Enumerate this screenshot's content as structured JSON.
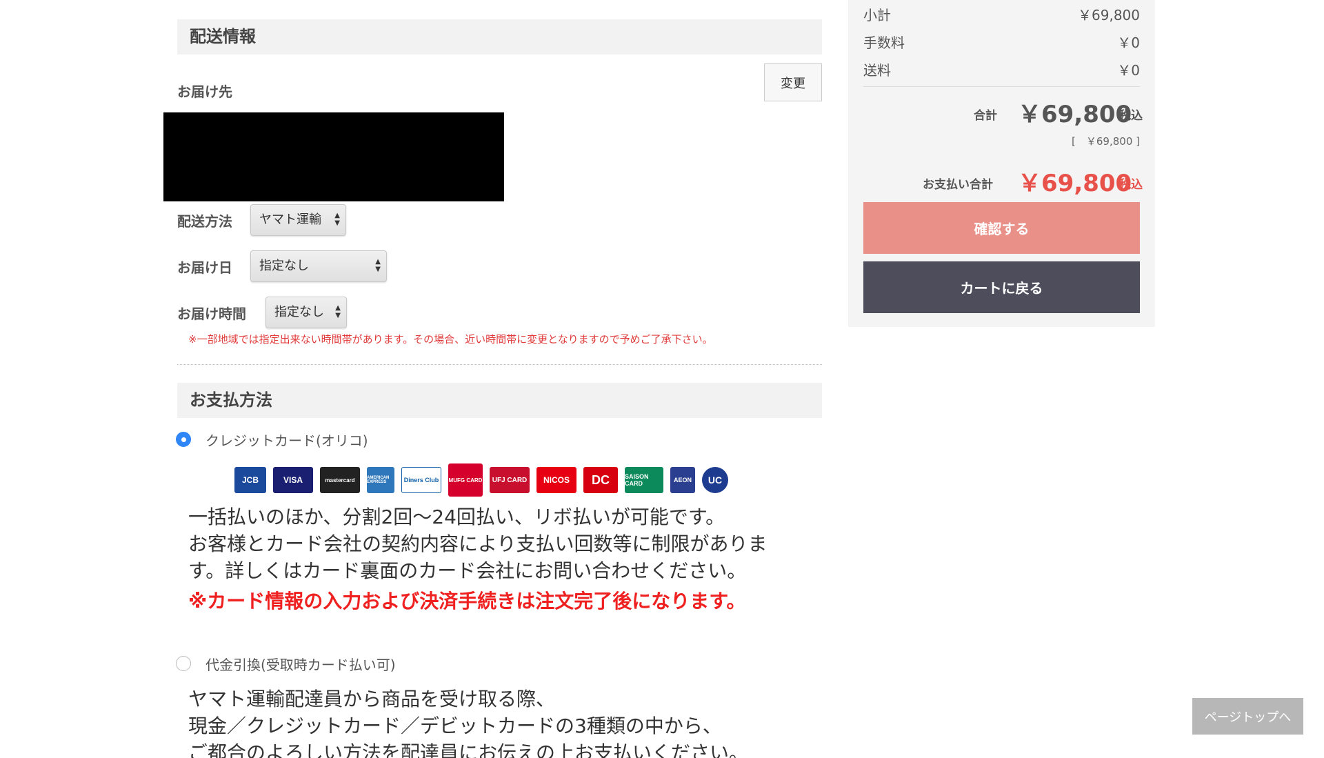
{
  "shipping": {
    "header": "配送情報",
    "destination_label": "お届け先",
    "change_button": "変更",
    "method_label": "配送方法",
    "method_value": "ヤマト運輸",
    "date_label": "お届け日",
    "date_value": "指定なし",
    "time_label": "お届け時間",
    "time_value": "指定なし",
    "notice": "※一部地域では指定出来ない時間帯があります。その場合、近い時間帯に変更となりますので予めご了承下さい。"
  },
  "payment": {
    "header": "お支払方法",
    "options": [
      {
        "label": "クレジットカード(オリコ)",
        "selected": true,
        "description": [
          "一括払いのほか、分割2回〜24回払い、リボ払いが可能です。",
          "お客様とカード会社の契約内容により支払い回数等に制限がありま",
          "す。詳しくはカード裏面のカード会社にお問い合わせください。"
        ],
        "warning": "※カード情報の入力および決済手続きは注文完了後になります。"
      },
      {
        "label": "代金引換(受取時カード払い可)",
        "selected": false,
        "description": [
          "ヤマト運輸配達員から商品を受け取る際、",
          "現金／クレジットカード／デビットカードの3種類の中から、",
          "ご都合のよろしい方法を配達員にお伝えの上お支払いください。"
        ]
      }
    ],
    "card_brands": [
      {
        "name": "jcb-logo",
        "text": "JCB",
        "color": "#1b4a9c"
      },
      {
        "name": "visa-logo",
        "text": "VISA",
        "color": "#1a1f71"
      },
      {
        "name": "mastercard-logo",
        "text": "mastercard",
        "color": "#222222"
      },
      {
        "name": "amex-logo",
        "text": "AMERICAN EXPRESS",
        "color": "#2e77bb"
      },
      {
        "name": "diners-logo",
        "text": "Diners Club",
        "color": "#0c5ea8"
      },
      {
        "name": "mufg-logo",
        "text": "MUFG CARD",
        "color": "#d5002b"
      },
      {
        "name": "ufj-logo",
        "text": "UFJ CARD",
        "color": "#c8102e"
      },
      {
        "name": "nicos-logo",
        "text": "NICOS",
        "color": "#e60012"
      },
      {
        "name": "dc-logo",
        "text": "DC",
        "color": "#d7000f"
      },
      {
        "name": "saison-logo",
        "text": "SAISON CARD",
        "color": "#0d8a5c"
      },
      {
        "name": "aeon-logo",
        "text": "AEON",
        "color": "#2a3f8f"
      },
      {
        "name": "uc-logo",
        "text": "UC",
        "color": "#1d3b8f"
      }
    ]
  },
  "summary": {
    "subtotal_label": "小計",
    "subtotal_value": "￥69,800",
    "fee_label": "手数料",
    "fee_value": "￥0",
    "shipping_label": "送料",
    "shipping_value": "￥0",
    "total_label": "合計",
    "total_value": "￥69,800",
    "tax_label": "税込",
    "tax_breakdown": "[　￥69,800 ]",
    "payment_total_label": "お支払い合計",
    "payment_total_value": "￥69,800",
    "payment_tax_label": "税込",
    "confirm_button": "確認する",
    "back_button": "カートに戻る"
  },
  "page_top": "ページトップへ",
  "colors": {
    "accent_red": "#e8504a",
    "confirm_button": "#e99089",
    "back_button": "#4e4d5c",
    "radio_blue": "#2f86f6"
  }
}
